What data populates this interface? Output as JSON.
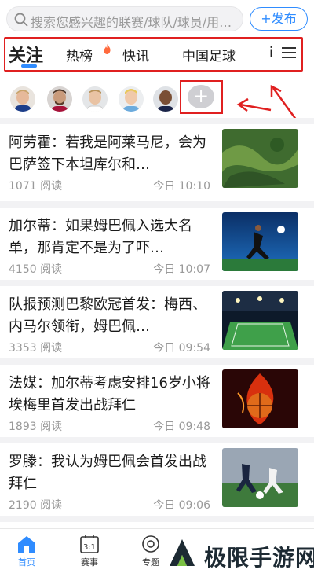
{
  "search": {
    "placeholder": "搜索您感兴趣的联赛/球队/球员/用…",
    "icon": "search-icon"
  },
  "publish_label": "+发布",
  "tabs": [
    {
      "label": "关注",
      "active": true
    },
    {
      "label": "热榜",
      "badge_icon": "fire-icon"
    },
    {
      "label": "快讯"
    },
    {
      "label": "中国足球"
    },
    {
      "label": "i"
    }
  ],
  "followed": {
    "avatars": [
      "avatar-1",
      "avatar-2",
      "avatar-3",
      "avatar-4",
      "avatar-5"
    ],
    "add_label": "+"
  },
  "news": [
    {
      "title": "阿劳霍：若我是阿莱马尼，会为巴萨签下本坦库尔和…",
      "reads": "1071 阅读",
      "time": "今日 10:10",
      "thumb": "aerial-green-landscape"
    },
    {
      "title": "加尔蒂：如果姆巴佩入选大名单，那肯定不是为了吓…",
      "reads": "4150 阅读",
      "time": "今日 10:07",
      "thumb": "soccer-player-kick"
    },
    {
      "title": "队报预测巴黎欧冠首发：梅西、内马尔领衔，姆巴佩…",
      "reads": "3353 阅读",
      "time": "今日 09:54",
      "thumb": "stadium-pitch"
    },
    {
      "title": "法媒：加尔蒂考虑安排16岁小将埃梅里首发出战拜仁",
      "reads": "1893 阅读",
      "time": "今日 09:48",
      "thumb": "flaming-basketball"
    },
    {
      "title": "罗滕：我认为姆巴佩会首发出战拜仁",
      "reads": "2190 阅读",
      "time": "今日 09:06",
      "thumb": "soccer-match-action"
    }
  ],
  "bottom_nav": [
    {
      "label": "首页",
      "icon": "home-icon",
      "active": true
    },
    {
      "label": "赛事",
      "icon": "calendar-icon",
      "date": "3:1"
    },
    {
      "label": "专题",
      "icon": "topic-icon"
    }
  ],
  "watermark": "极限手游网",
  "colors": {
    "accent": "#2f8cff",
    "annotation": "#e02020"
  }
}
